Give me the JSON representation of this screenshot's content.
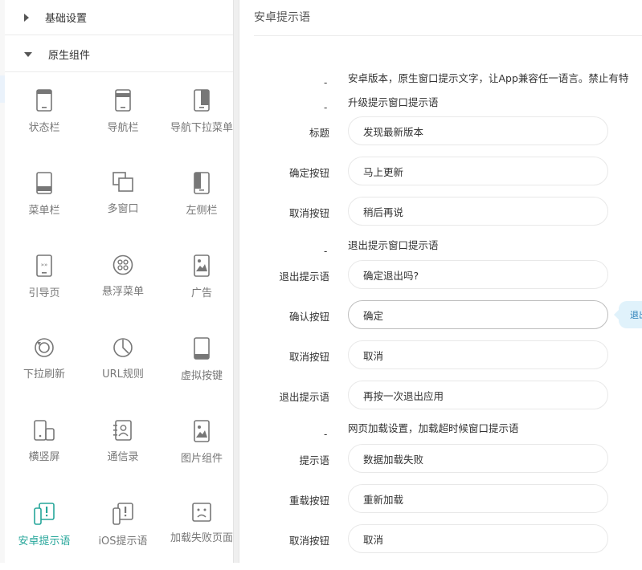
{
  "sidebar": {
    "sections": [
      {
        "label": "基础设置",
        "expanded": false
      },
      {
        "label": "原生组件",
        "expanded": true
      }
    ],
    "components": [
      {
        "label": "状态栏",
        "icon": "phone-status-bar-icon"
      },
      {
        "label": "导航栏",
        "icon": "phone-nav-bar-icon"
      },
      {
        "label": "导航下拉菜单",
        "icon": "phone-nav-dropdown-icon"
      },
      {
        "label": "菜单栏",
        "icon": "phone-menu-bar-icon"
      },
      {
        "label": "多窗口",
        "icon": "multi-window-icon"
      },
      {
        "label": "左侧栏",
        "icon": "phone-left-sidebar-icon"
      },
      {
        "label": "引导页",
        "icon": "guide-page-icon"
      },
      {
        "label": "悬浮菜单",
        "icon": "floating-menu-icon"
      },
      {
        "label": "广告",
        "icon": "ad-image-icon"
      },
      {
        "label": "下拉刷新",
        "icon": "pull-refresh-icon"
      },
      {
        "label": "URL规则",
        "icon": "url-rule-icon"
      },
      {
        "label": "虚拟按键",
        "icon": "virtual-keys-icon"
      },
      {
        "label": "横竖屏",
        "icon": "screen-rotate-icon"
      },
      {
        "label": "通信录",
        "icon": "contacts-icon"
      },
      {
        "label": "图片组件",
        "icon": "image-component-icon"
      },
      {
        "label": "安卓提示语",
        "icon": "android-alert-icon",
        "active": true
      },
      {
        "label": "iOS提示语",
        "icon": "ios-alert-icon"
      },
      {
        "label": "加载失败页面",
        "icon": "load-failed-face-icon"
      }
    ]
  },
  "main": {
    "title": "安卓提示语",
    "intro": "安卓版本，原生窗口提示文字，让App兼容任一语言。禁止有特",
    "dash": "-",
    "groups": [
      {
        "heading": "升级提示窗口提示语",
        "fields": [
          {
            "label": "标题",
            "value": "发现最新版本"
          },
          {
            "label": "确定按钮",
            "value": "马上更新"
          },
          {
            "label": "取消按钮",
            "value": "稍后再说"
          }
        ]
      },
      {
        "heading": "退出提示窗口提示语",
        "fields": [
          {
            "label": "退出提示语",
            "value": "确定退出吗?"
          },
          {
            "label": "确认按钮",
            "value": "确定"
          },
          {
            "label": "取消按钮",
            "value": "取消"
          },
          {
            "label": "退出提示语",
            "value": "再按一次退出应用"
          }
        ]
      },
      {
        "heading": "网页加载设置，加载超时候窗口提示语",
        "fields": [
          {
            "label": "提示语",
            "value": "数据加载失败"
          },
          {
            "label": "重载按钮",
            "value": "重新加载"
          },
          {
            "label": "取消按钮",
            "value": "取消"
          }
        ]
      }
    ],
    "tooltip": "退出"
  },
  "colors": {
    "accent": "#26a69a",
    "icon_gray": "#777777",
    "border": "#e8e8e8"
  }
}
